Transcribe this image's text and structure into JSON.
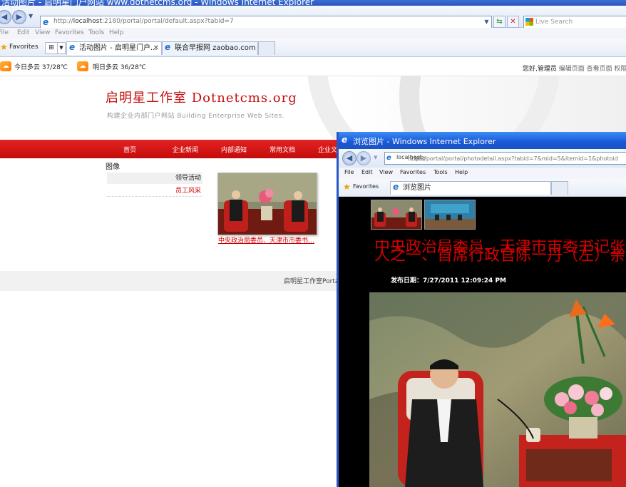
{
  "main_window": {
    "title": "活动图片 - 启明星门户网站 www.dotnetcms.org - Windows Internet Explorer",
    "address": {
      "prefix": "http://",
      "host": "localhost",
      "rest": ":2180/portal/portal/default.aspx?tabid=7"
    },
    "search_placeholder": "Live Search",
    "menu": [
      "File",
      "Edit",
      "View",
      "Favorites",
      "Tools",
      "Help"
    ],
    "favorites_label": "Favorites",
    "tabs": [
      {
        "label": "活动图片 - 启明星门户..."
      },
      {
        "label": "联合早报网 zaobao.com"
      }
    ]
  },
  "weather": {
    "today": "今日多云 37/28℃",
    "tomorrow": "明日多云 36/28℃",
    "greeting": "您好,管理员",
    "links": "编辑页面 查看页面 权限"
  },
  "site": {
    "logo_title": "启明星工作室 Dotnetcms.org",
    "logo_subtitle": "构建企业内部门户网站 Building Enterprise Web Sites.",
    "nav": [
      "首页",
      "企业新闻",
      "内部通知",
      "常用文档",
      "企业文"
    ],
    "section_label": "图像",
    "side_items": [
      "领导活动",
      "员工风采"
    ],
    "photo_caption": "中央政治局委员、天津市市委书…",
    "footer": "启明星工作室Porta"
  },
  "popup": {
    "title": "浏览图片 - Windows Internet Explorer",
    "address": {
      "prefix": "http://",
      "host": "localhost",
      "rest": ":2180/portal/portal/photodetail.aspx?tabid=7&mid=5&itemid=1&photoid"
    },
    "menu": [
      "File",
      "Edit",
      "View",
      "Favorites",
      "Tools",
      "Help"
    ],
    "favorites_label": "Favorites",
    "tab_label": "浏览图片",
    "headline_line1": "中央政治局委员、天津市市委书记张高丽",
    "headline_line2": "人之一、首席行政官陈一丹（左）亲切会",
    "date": "发布日期：7/27/2011 12:09:24 PM"
  },
  "colors": {
    "accent_red": "#c40c0c",
    "ie_blue": "#1958d6"
  }
}
